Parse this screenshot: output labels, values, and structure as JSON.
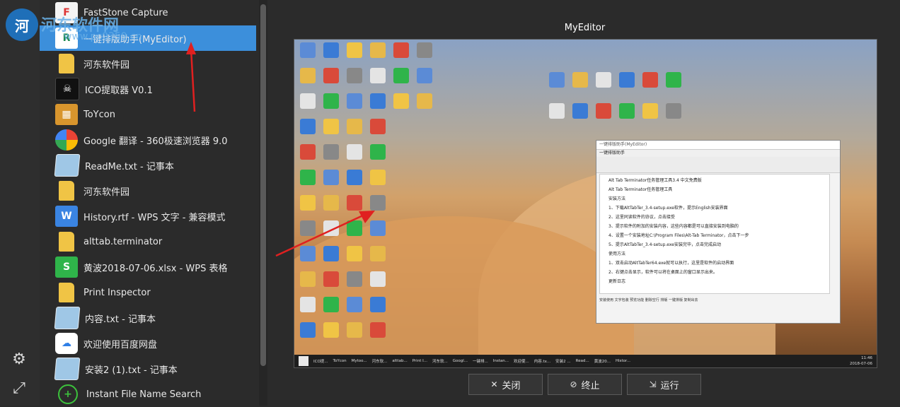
{
  "watermark": {
    "title": "河东软件网",
    "url": "www.pc0359.cn"
  },
  "list": {
    "items": [
      {
        "label": "FastStone Capture",
        "icon": "faststone-icon",
        "kind": "fs"
      },
      {
        "label": "一键排版助手(MyEditor)",
        "icon": "myeditor-icon",
        "kind": "myed",
        "selected": true
      },
      {
        "label": "河东软件园",
        "icon": "folder-icon",
        "kind": "folder"
      },
      {
        "label": "ICO提取器 V0.1",
        "icon": "ico-extractor-icon",
        "kind": "dark"
      },
      {
        "label": "ToYcon",
        "icon": "toycon-icon",
        "kind": "box"
      },
      {
        "label": "Google 翻译 - 360极速浏览器 9.0",
        "icon": "browser-icon",
        "kind": "google"
      },
      {
        "label": "ReadMe.txt - 记事本",
        "icon": "notepad-icon",
        "kind": "note"
      },
      {
        "label": "河东软件园",
        "icon": "folder-icon",
        "kind": "folder"
      },
      {
        "label": "History.rtf - WPS 文字 - 兼容模式",
        "icon": "wps-writer-icon",
        "kind": "wps-w"
      },
      {
        "label": "alttab.terminator",
        "icon": "folder-icon",
        "kind": "folder"
      },
      {
        "label": "黄波2018-07-06.xlsx - WPS 表格",
        "icon": "wps-sheet-icon",
        "kind": "wps-s"
      },
      {
        "label": "Print Inspector",
        "icon": "folder-icon",
        "kind": "folder"
      },
      {
        "label": "内容.txt - 记事本",
        "icon": "notepad-icon",
        "kind": "note"
      },
      {
        "label": "欢迎使用百度网盘",
        "icon": "baidu-netdisk-icon",
        "kind": "baidu"
      },
      {
        "label": "安装2 (1).txt - 记事本",
        "icon": "notepad-icon",
        "kind": "note"
      },
      {
        "label": "Instant File Name Search",
        "icon": "crosshair-icon",
        "kind": "green-ring"
      }
    ]
  },
  "preview": {
    "title": "MyEditor",
    "window_title": "一键排版助手(MyEditor)",
    "window_menu": "一键排版助手",
    "body_lines": [
      "Alt Tab Terminator任务管理工具3.4 中文免费版",
      "Alt Tab Terminator任务管理工具",
      "安装方法",
      "1、下载AltTabTer_3.4-setup.exe软件，提示English安装界面",
      "2、这里同读软件的协议，点击接受",
      "3、提示软件的附加的安装内容，这些内容都是可以直接安装到电脑的",
      "4、设置一个安装地址C:\\Program Files\\Alt-Tab Terminator，点击下一步",
      "5、提示AltTabTer_3.4-setup.exe安装完毕，点击完成启动",
      "使用方法",
      "1、双击启动AltTabTer64.exe就可以执行，这里是软件的启动界面",
      "2、右键点击显示，软件可以将在桌面上的窗口显示出来。",
      "更新日志"
    ],
    "window_footer": "安装使用 文字包装 预览功能 删除空行 排版 一键排版 复制出去",
    "taskbar_items": [
      "ICO提...",
      "ToYcon",
      "Mytoo...",
      "河东软...",
      "alttab...",
      "Print I...",
      "河东软...",
      "Googl...",
      "一键排...",
      "Instan...",
      "欢迎使...",
      "内容.tx...",
      "安装2 ...",
      "Read...",
      "黄波20...",
      "Histor..."
    ],
    "clock_time": "11:46",
    "clock_date": "2018-07-06"
  },
  "buttons": {
    "close": "关闭",
    "terminate": "终止",
    "run": "运行"
  },
  "colors": {
    "selected": "#3c8fdb",
    "arrow": "#e02020"
  }
}
